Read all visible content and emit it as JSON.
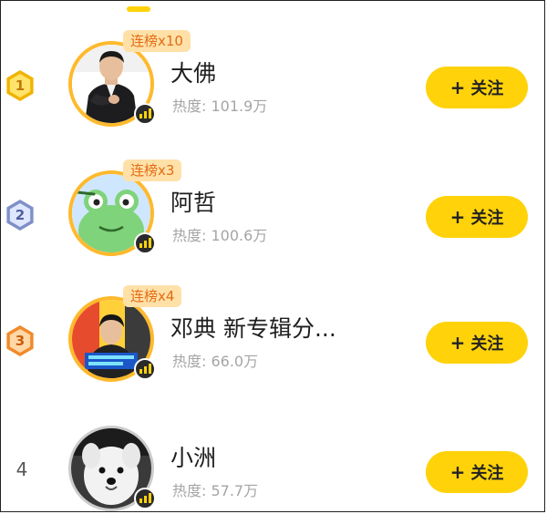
{
  "list": [
    {
      "rank": "1",
      "rank_style": "gold",
      "streak": "连榜x10",
      "name": "大佛",
      "heat": "热度: 101.9万",
      "follow": "关注",
      "avatar": "man-black-suit"
    },
    {
      "rank": "2",
      "rank_style": "silver",
      "streak": "连榜x3",
      "name": "阿哲",
      "heat": "热度: 100.6万",
      "follow": "关注",
      "avatar": "green-frog"
    },
    {
      "rank": "3",
      "rank_style": "bronze",
      "streak": "连榜x4",
      "name": "邓典 新专辑分...",
      "heat": "热度: 66.0万",
      "follow": "关注",
      "avatar": "man-album-poster"
    },
    {
      "rank": "4",
      "rank_style": "plain",
      "streak": "",
      "name": "小洲",
      "heat": "热度: 57.7万",
      "follow": "关注",
      "avatar": "white-dog"
    }
  ],
  "icons": {
    "follow": "plus-icon",
    "live": "live-bars-icon"
  },
  "colors": {
    "accent": "#ffd20a",
    "streak_bg": "#ffe1a8",
    "streak_text": "#e56b14",
    "muted_text": "#a5a5a5"
  }
}
